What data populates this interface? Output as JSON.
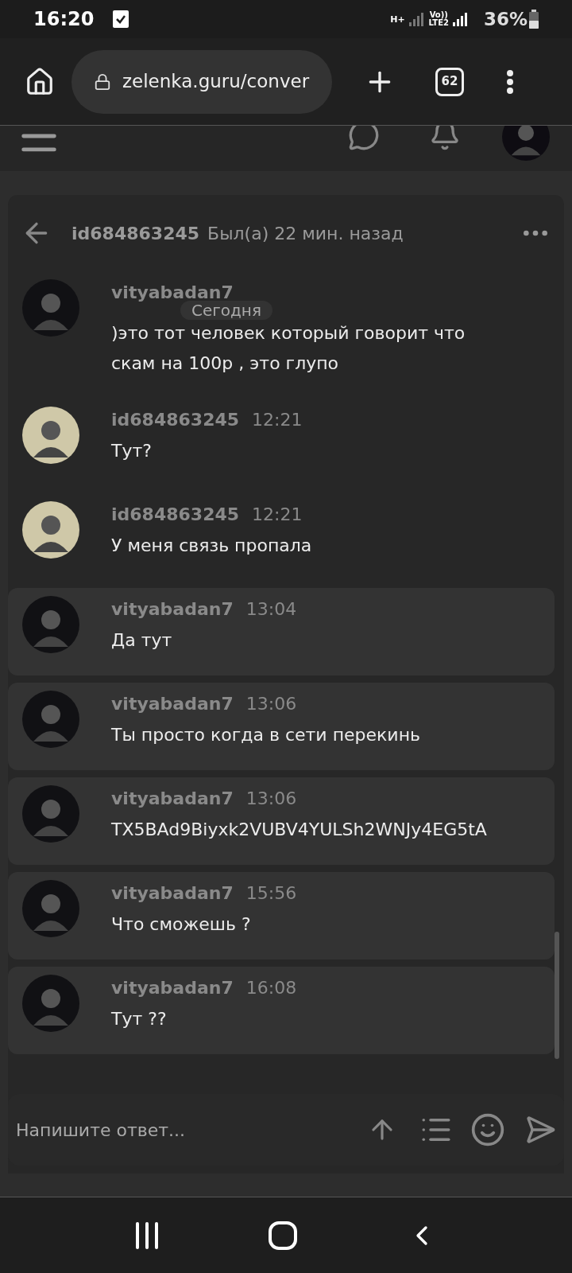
{
  "status_bar": {
    "time": "16:20",
    "network_1": "H+",
    "network_2": "Vo))",
    "network_3": "LTE2",
    "battery": "36%"
  },
  "browser": {
    "url": "zelenka.guru/conver",
    "tab_count": "62"
  },
  "conversation": {
    "title": "id684863245",
    "last_seen": "Был(а) 22 мин. назад",
    "date_badge": "Сегодня",
    "messages": [
      {
        "author": "vityabadan7",
        "text": ")это тот человек который говорит что скам на 100р , это глупо",
        "color": "#111114",
        "highlighted": false
      },
      {
        "author": "id684863245",
        "time": "12:21",
        "text": "Тут?",
        "color": "#cfc8a8",
        "highlighted": false
      },
      {
        "author": "id684863245",
        "time": "12:21",
        "text": "У меня связь пропала",
        "color": "#cfc8a8",
        "highlighted": false
      },
      {
        "author": "vityabadan7",
        "time": "13:04",
        "text": "Да тут",
        "color": "#111114",
        "highlighted": true
      },
      {
        "author": "vityabadan7",
        "time": "13:06",
        "text": "Ты просто когда в сети перекинь",
        "color": "#111114",
        "highlighted": true
      },
      {
        "author": "vityabadan7",
        "time": "13:06",
        "text": "TX5BAd9Biyxk2VUBV4YULSh2WNJy4EG5tA",
        "color": "#111114",
        "highlighted": true
      },
      {
        "author": "vityabadan7",
        "time": "15:56",
        "text": "Что сможешь ?",
        "color": "#111114",
        "highlighted": true
      },
      {
        "author": "vityabadan7",
        "time": "16:08",
        "text": "Тут ??",
        "color": "#111114",
        "highlighted": true
      }
    ]
  },
  "composer": {
    "placeholder": "Напишите ответ..."
  }
}
